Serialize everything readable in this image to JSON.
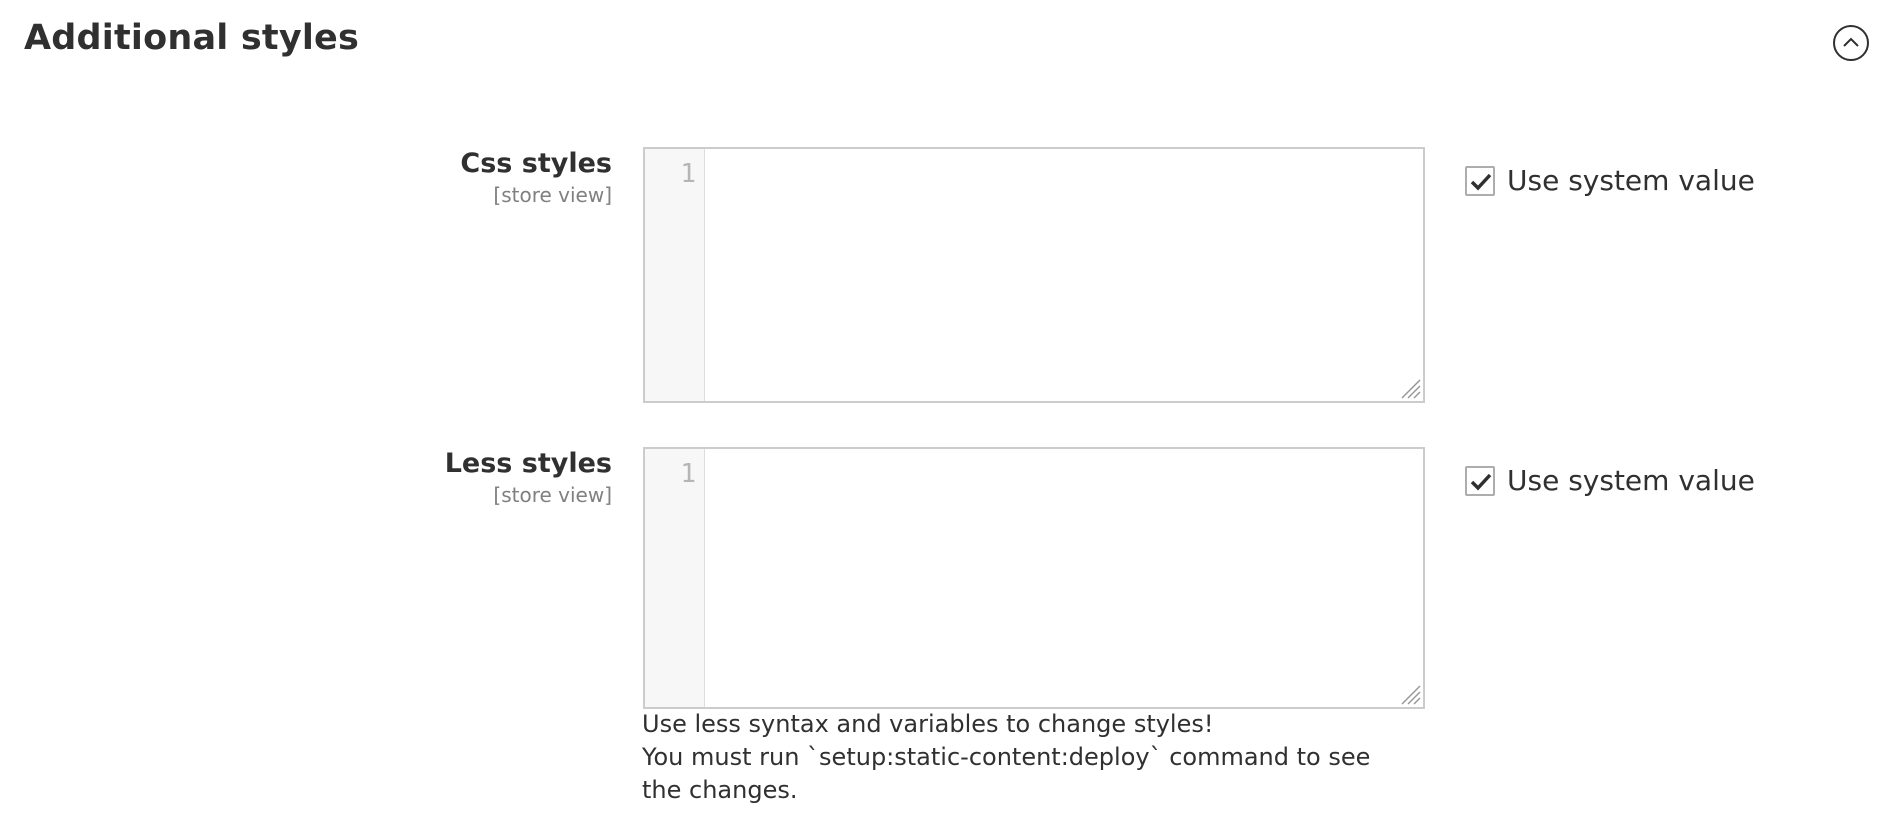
{
  "section": {
    "title": "Additional styles",
    "toggle_icon": "chevron-up-circle-icon"
  },
  "fields": {
    "css": {
      "label": "Css styles",
      "scope": "[store view]",
      "line_number": "1",
      "value": "",
      "use_system_label": "Use system value",
      "use_system_checked": true
    },
    "less": {
      "label": "Less styles",
      "scope": "[store view]",
      "line_number": "1",
      "value": "",
      "use_system_label": "Use system value",
      "use_system_checked": true,
      "note_line_1": "Use less syntax and variables to change styles!",
      "note_line_2": "You must run `setup:static-content:deploy` command to see the changes."
    }
  },
  "colors": {
    "text": "#303030",
    "scope": "#808080",
    "border": "#cccccc",
    "gutter": "#f7f7f7"
  }
}
